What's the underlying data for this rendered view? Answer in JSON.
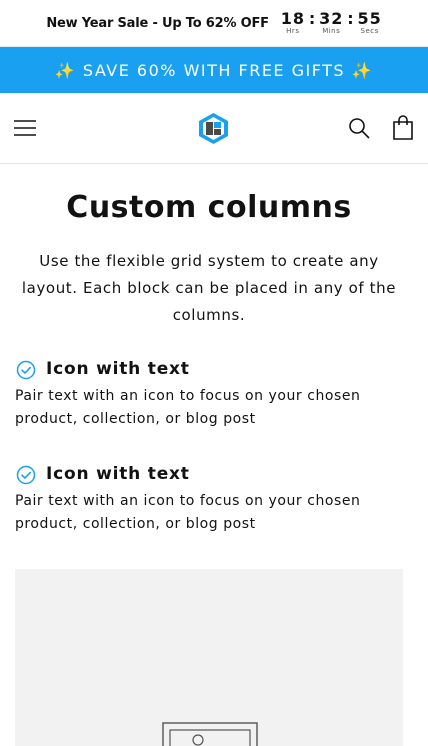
{
  "promo": {
    "text": "New Year Sale - Up To 62% OFF",
    "countdown": {
      "hours": "18",
      "hours_label": "Hrs",
      "minutes": "32",
      "minutes_label": "Mins",
      "seconds": "55",
      "seconds_label": "Secs",
      "separator": ":"
    }
  },
  "announcement": {
    "text": "✨ SAVE 60% WITH FREE GIFTS ✨",
    "background": "#1aa0f0"
  },
  "header": {
    "icons": [
      "menu-icon",
      "logo",
      "search-icon",
      "cart-icon"
    ],
    "brand_colors": [
      "#1aa0f0",
      "#4a4a4a"
    ]
  },
  "main": {
    "title": "Custom columns",
    "intro": "Use the flexible grid system to create any layout. Each block can be placed in any of the columns.",
    "columns": [
      {
        "icon": "check-circle-icon",
        "title": "Icon with text",
        "text": "Pair text with an icon to focus on your chosen product, collection, or blog post"
      },
      {
        "icon": "check-circle-icon",
        "title": "Icon with text",
        "text": "Pair text with an icon to focus on your chosen product, collection, or blog post"
      }
    ],
    "image_placeholder": "image-placeholder-icon",
    "accent_color": "#1aa0f0"
  }
}
